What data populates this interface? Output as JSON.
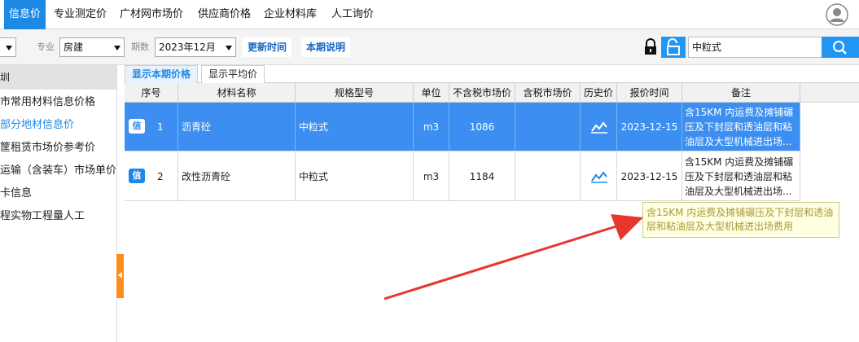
{
  "topnav": {
    "tabs": [
      {
        "label": "信息价",
        "active": true
      },
      {
        "label": "专业测定价",
        "active": false
      },
      {
        "label": "广材网市场价",
        "active": false
      },
      {
        "label": "供应商价格",
        "active": false
      },
      {
        "label": "企业材料库",
        "active": false
      },
      {
        "label": "人工询价",
        "active": false
      }
    ]
  },
  "toolbar": {
    "specialty_label": "专业",
    "specialty_value": "房建",
    "period_label": "期数",
    "period_value": "2023年12月",
    "update_time_button": "更新时间",
    "period_note_button": "本期说明",
    "search_value": "中粒式"
  },
  "sidebar": {
    "header": "圳",
    "items": [
      {
        "label": "市常用材料信息价格",
        "active": false
      },
      {
        "label": "部分地材信息价",
        "active": true
      },
      {
        "label": "筐租赁市场价参考价",
        "active": false
      },
      {
        "label": "运输（含装车）市场单价",
        "active": false
      },
      {
        "label": "卡信息",
        "active": false
      },
      {
        "label": "程实物工程量人工",
        "active": false
      }
    ]
  },
  "subtabs": [
    {
      "label": "显示本期价格",
      "active": true
    },
    {
      "label": "显示平均价",
      "active": false
    }
  ],
  "table": {
    "columns": [
      "序号",
      "材料名称",
      "规格型号",
      "单位",
      "不含税市场价",
      "含税市场价",
      "历史价",
      "报价时间",
      "备注"
    ],
    "rows": [
      {
        "badge": "信",
        "seq": "1",
        "name": "沥青砼",
        "spec": "中粒式",
        "unit": "m3",
        "price_ex_tax": "1086",
        "price_inc_tax": "",
        "quote_date": "2023-12-15",
        "note": "含15KM 内运费及摊铺碾压及下封层和透油层和粘油层及大型机械进出场...",
        "selected": true
      },
      {
        "badge": "信",
        "seq": "2",
        "name": "改性沥青砼",
        "spec": "中粒式",
        "unit": "m3",
        "price_ex_tax": "1184",
        "price_inc_tax": "",
        "quote_date": "2023-12-15",
        "note": "含15KM 内运费及摊铺碾压及下封层和透油层和粘油层及大型机械进出场...",
        "selected": false
      }
    ]
  },
  "tooltip": {
    "text": "含15KM 内运费及摊铺碾压及下封层和透油层和粘油层及大型机械进出场费用"
  },
  "colors": {
    "accent": "#1e88e5",
    "selected_row": "#3c8ff0",
    "annotation_arrow": "#e8362f",
    "collapse_handle": "#ff8c1a"
  }
}
